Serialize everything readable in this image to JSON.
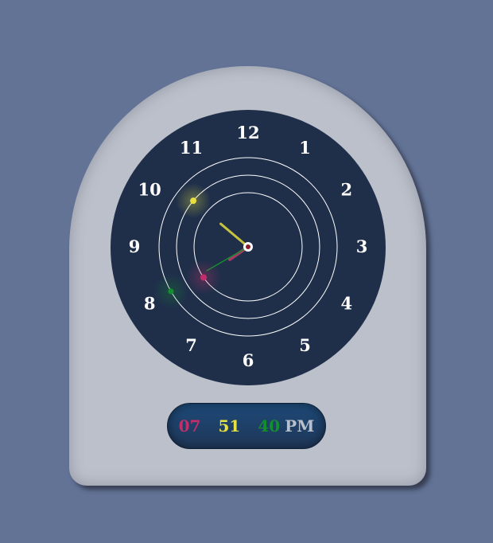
{
  "clock": {
    "numerals": [
      "12",
      "1",
      "2",
      "3",
      "4",
      "5",
      "6",
      "7",
      "8",
      "9",
      "10",
      "11"
    ],
    "time": {
      "hours": 7,
      "minutes": 51,
      "seconds": 40
    }
  },
  "digital": {
    "hours": "07",
    "minutes": "51",
    "seconds": "40",
    "ampm": "PM"
  },
  "colors": {
    "background": "#627396",
    "body": "#bcc0ca",
    "dial": "#1f2f4a",
    "hour": "#c22e6a",
    "minute": "#e7e040",
    "second": "#148f2e",
    "ampm": "#b9bfcb"
  }
}
